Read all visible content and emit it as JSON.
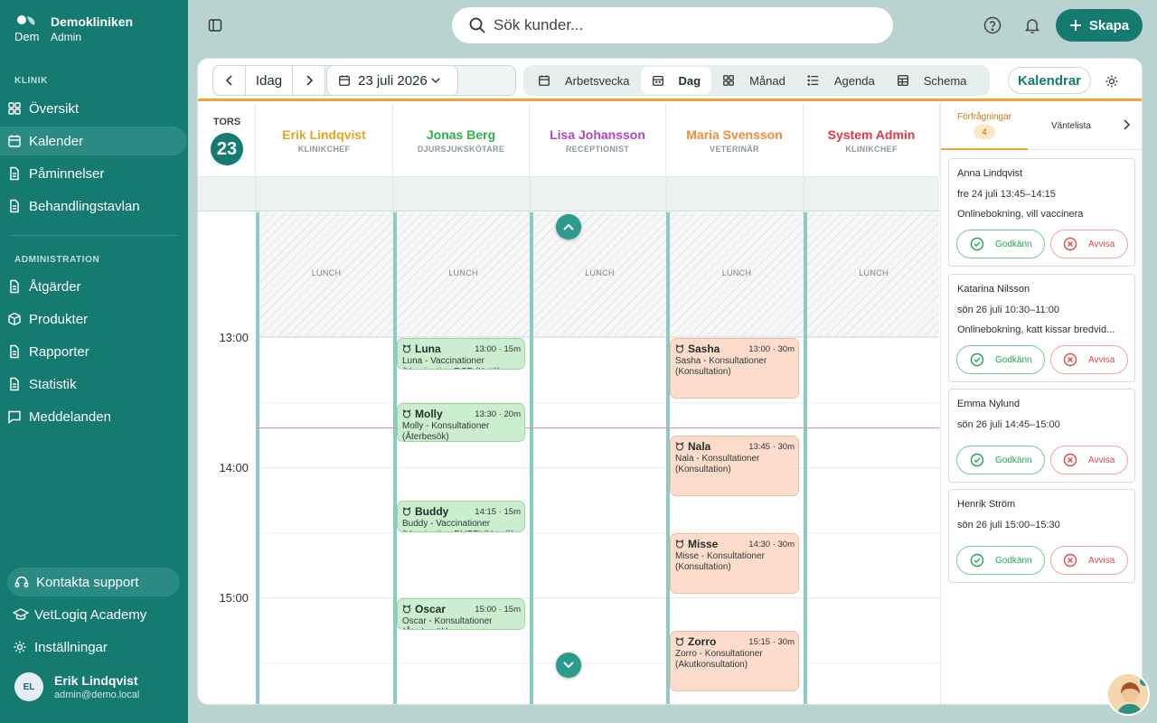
{
  "brand": {
    "name": "Demokliniken",
    "role": "Admin",
    "logo_text": "Dem"
  },
  "nav": {
    "klinik_label": "KLINIK",
    "klinik_items": [
      {
        "label": "Översikt",
        "icon": "grid-icon"
      },
      {
        "label": "Kalender",
        "icon": "calendar-icon",
        "active": true
      },
      {
        "label": "Påminnelser",
        "icon": "document-icon"
      },
      {
        "label": "Behandlingstavlan",
        "icon": "document-icon"
      }
    ],
    "admin_label": "ADMINISTRATION",
    "admin_items": [
      {
        "label": "Åtgärder",
        "icon": "document-icon"
      },
      {
        "label": "Produkter",
        "icon": "box-icon"
      },
      {
        "label": "Rapporter",
        "icon": "document-icon"
      },
      {
        "label": "Statistik",
        "icon": "document-icon"
      },
      {
        "label": "Meddelanden",
        "icon": "message-icon"
      }
    ],
    "support": "Kontakta support",
    "academy": "VetLogiq Academy",
    "settings": "Inställningar"
  },
  "user": {
    "initials": "EL",
    "name": "Erik Lindqvist",
    "email": "admin@demo.local"
  },
  "topbar": {
    "search_placeholder": "Sök kunder...",
    "create_label": "Skapa"
  },
  "toolbar": {
    "today": "Idag",
    "date": "23 juli 2026",
    "views": [
      {
        "label": "Arbetsvecka",
        "icon": "calendar-icon"
      },
      {
        "label": "Dag",
        "icon": "calendar-icon",
        "active": true
      },
      {
        "label": "Månad",
        "icon": "grid-icon"
      },
      {
        "label": "Agenda",
        "icon": "list-icon"
      },
      {
        "label": "Schema",
        "icon": "table-icon"
      }
    ],
    "calendars_label": "Kalendrar"
  },
  "day": {
    "dow": "TORS",
    "num": "23"
  },
  "staff": [
    {
      "name": "Erik Lindqvist",
      "role": "KLINIKCHEF",
      "color": "#e9a321"
    },
    {
      "name": "Jonas Berg",
      "role": "DJURSJUKSKÖTARE",
      "color": "#2bb34a"
    },
    {
      "name": "Lisa Johansson",
      "role": "RECEPTIONIST",
      "color": "#b145c8"
    },
    {
      "name": "Maria Svensson",
      "role": "VETERINÄR",
      "color": "#f28c3a"
    },
    {
      "name": "System Admin",
      "role": "KLINIKCHEF",
      "color": "#e0384a"
    }
  ],
  "lunch_label": "LUNCH",
  "times": [
    "13:00",
    "14:00",
    "15:00"
  ],
  "events": [
    {
      "col": 1,
      "name": "Luna",
      "time": "13:00 · 15m",
      "desc": "Luna - Vaccinationer (Vaccination RCP (Katt))",
      "kind": "green"
    },
    {
      "col": 1,
      "name": "Molly",
      "time": "13:30 · 20m",
      "desc": "Molly - Konsultationer (Återbesök)",
      "kind": "green"
    },
    {
      "col": 1,
      "name": "Buddy",
      "time": "14:15 · 15m",
      "desc": "Buddy - Vaccinationer (Vaccination DHPPi (Hund))",
      "kind": "green"
    },
    {
      "col": 1,
      "name": "Oscar",
      "time": "15:00 · 15m",
      "desc": "Oscar - Konsultationer (Återbesök)",
      "kind": "green"
    },
    {
      "col": 3,
      "name": "Sasha",
      "time": "13:00 · 30m",
      "desc": "Sasha - Konsultationer (Konsultation)",
      "kind": "orange"
    },
    {
      "col": 3,
      "name": "Nala",
      "time": "13:45 · 30m",
      "desc": "Nala - Konsultationer (Konsultation)",
      "kind": "orange"
    },
    {
      "col": 3,
      "name": "Misse",
      "time": "14:30 · 30m",
      "desc": "Misse - Konsultationer (Konsultation)",
      "kind": "orange"
    },
    {
      "col": 3,
      "name": "Zorro",
      "time": "15:15 · 30m",
      "desc": "Zorro - Konsultationer (Akutkonsultation)",
      "kind": "orange"
    }
  ],
  "requests": {
    "tab_requests": "Förfrågningar",
    "count": "4",
    "tab_waitlist": "Väntelista",
    "approve_label": "Godkänn",
    "reject_label": "Avvisa",
    "items": [
      {
        "name": "Anna Lindqvist",
        "time": "fre 24 juli 13:45–14:15",
        "note": "Onlinebokning, vill vaccinera"
      },
      {
        "name": "Katarina Nilsson",
        "time": "sön 26 juli 10:30–11:00",
        "note": "Onlinebokning, katt kissar bredvid..."
      },
      {
        "name": "Emma Nylund",
        "time": "sön 26 juli 14:45–15:00",
        "note": ""
      },
      {
        "name": "Henrik Ström",
        "time": "sön 26 juli 15:00–15:30",
        "note": ""
      }
    ]
  },
  "colors": {
    "primary": "#157a70",
    "accent": "#f1a23a",
    "now_line": "#f08f8f"
  }
}
